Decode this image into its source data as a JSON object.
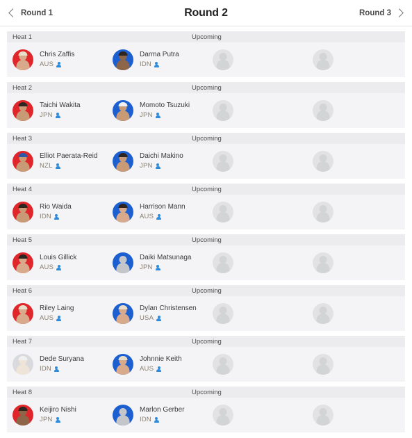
{
  "header": {
    "prev_label": "Round 1",
    "title": "Round 2",
    "next_label": "Round 3",
    "prev_icon": "chevron-left-icon",
    "next_icon": "chevron-right-icon"
  },
  "colors": {
    "red_jersey": "#e0262b",
    "blue_jersey": "#1c5fd0",
    "bar_background": "#ececee",
    "row_background": "#f4f4f6",
    "profile_icon": "#2e8bdb",
    "country_text": "#8a8070"
  },
  "labels": {
    "status_upcoming": "Upcoming",
    "profile_icon_name": "profile-link-icon",
    "placeholder_name": "empty-slot-avatar"
  },
  "heats": [
    {
      "label": "Heat 1",
      "status": "Upcoming",
      "athletes": [
        {
          "name": "Chris Zaffis",
          "country": "AUS",
          "jersey": "red",
          "tone": "tone-a",
          "hair": "light"
        },
        {
          "name": "Darma Putra",
          "country": "IDN",
          "jersey": "blue",
          "tone": "tone-b",
          "hair": "dark"
        },
        {
          "name": "",
          "country": "",
          "jersey": "empty",
          "tone": "tone-ghost",
          "hair": "none"
        },
        {
          "name": "",
          "country": "",
          "jersey": "empty",
          "tone": "tone-ghost",
          "hair": "none"
        }
      ]
    },
    {
      "label": "Heat 2",
      "status": "Upcoming",
      "athletes": [
        {
          "name": "Taichi Wakita",
          "country": "JPN",
          "jersey": "red",
          "tone": "tone-c",
          "hair": "dark"
        },
        {
          "name": "Momoto Tsuzuki",
          "country": "JPN",
          "jersey": "blue",
          "tone": "tone-c",
          "hair": "capw"
        },
        {
          "name": "",
          "country": "",
          "jersey": "empty",
          "tone": "tone-ghost",
          "hair": "none"
        },
        {
          "name": "",
          "country": "",
          "jersey": "empty",
          "tone": "tone-ghost",
          "hair": "none"
        }
      ]
    },
    {
      "label": "Heat 3",
      "status": "Upcoming",
      "athletes": [
        {
          "name": "Elliot Paerata-Reid",
          "country": "NZL",
          "jersey": "red",
          "tone": "tone-c",
          "hair": "cap"
        },
        {
          "name": "Daichi Makino",
          "country": "JPN",
          "jersey": "blue",
          "tone": "tone-c",
          "hair": "dark"
        },
        {
          "name": "",
          "country": "",
          "jersey": "empty",
          "tone": "tone-ghost",
          "hair": "none"
        },
        {
          "name": "",
          "country": "",
          "jersey": "empty",
          "tone": "tone-ghost",
          "hair": "none"
        }
      ]
    },
    {
      "label": "Heat 4",
      "status": "Upcoming",
      "athletes": [
        {
          "name": "Rio Waida",
          "country": "IDN",
          "jersey": "red",
          "tone": "tone-c",
          "hair": "dark"
        },
        {
          "name": "Harrison Mann",
          "country": "AUS",
          "jersey": "blue",
          "tone": "tone-a",
          "hair": "dark"
        },
        {
          "name": "",
          "country": "",
          "jersey": "empty",
          "tone": "tone-ghost",
          "hair": "none"
        },
        {
          "name": "",
          "country": "",
          "jersey": "empty",
          "tone": "tone-ghost",
          "hair": "none"
        }
      ]
    },
    {
      "label": "Heat 5",
      "status": "Upcoming",
      "athletes": [
        {
          "name": "Louis Gillick",
          "country": "AUS",
          "jersey": "red",
          "tone": "tone-a",
          "hair": "dark"
        },
        {
          "name": "Daiki Matsunaga",
          "country": "JPN",
          "jersey": "blue",
          "tone": "tone-grey",
          "hair": "none"
        },
        {
          "name": "",
          "country": "",
          "jersey": "empty",
          "tone": "tone-ghost",
          "hair": "none"
        },
        {
          "name": "",
          "country": "",
          "jersey": "empty",
          "tone": "tone-ghost",
          "hair": "none"
        }
      ]
    },
    {
      "label": "Heat 6",
      "status": "Upcoming",
      "athletes": [
        {
          "name": "Riley Laing",
          "country": "AUS",
          "jersey": "red",
          "tone": "tone-a",
          "hair": "light"
        },
        {
          "name": "Dylan Christensen",
          "country": "USA",
          "jersey": "blue",
          "tone": "tone-a",
          "hair": "light"
        },
        {
          "name": "",
          "country": "",
          "jersey": "empty",
          "tone": "tone-ghost",
          "hair": "none"
        },
        {
          "name": "",
          "country": "",
          "jersey": "empty",
          "tone": "tone-ghost",
          "hair": "none"
        }
      ]
    },
    {
      "label": "Heat 7",
      "status": "Upcoming",
      "athletes": [
        {
          "name": "Dede Suryana",
          "country": "IDN",
          "jersey": "pale",
          "tone": "tone-d",
          "hair": "capw"
        },
        {
          "name": "Johnnie Keith",
          "country": "AUS",
          "jersey": "blue",
          "tone": "tone-a",
          "hair": "light"
        },
        {
          "name": "",
          "country": "",
          "jersey": "empty",
          "tone": "tone-ghost",
          "hair": "none"
        },
        {
          "name": "",
          "country": "",
          "jersey": "empty",
          "tone": "tone-ghost",
          "hair": "none"
        }
      ]
    },
    {
      "label": "Heat 8",
      "status": "Upcoming",
      "athletes": [
        {
          "name": "Keijiro Nishi",
          "country": "JPN",
          "jersey": "red",
          "tone": "tone-b",
          "hair": "dark"
        },
        {
          "name": "Marlon Gerber",
          "country": "IDN",
          "jersey": "blue",
          "tone": "tone-grey",
          "hair": "none"
        },
        {
          "name": "",
          "country": "",
          "jersey": "empty",
          "tone": "tone-ghost",
          "hair": "none"
        },
        {
          "name": "",
          "country": "",
          "jersey": "empty",
          "tone": "tone-ghost",
          "hair": "none"
        }
      ]
    }
  ]
}
